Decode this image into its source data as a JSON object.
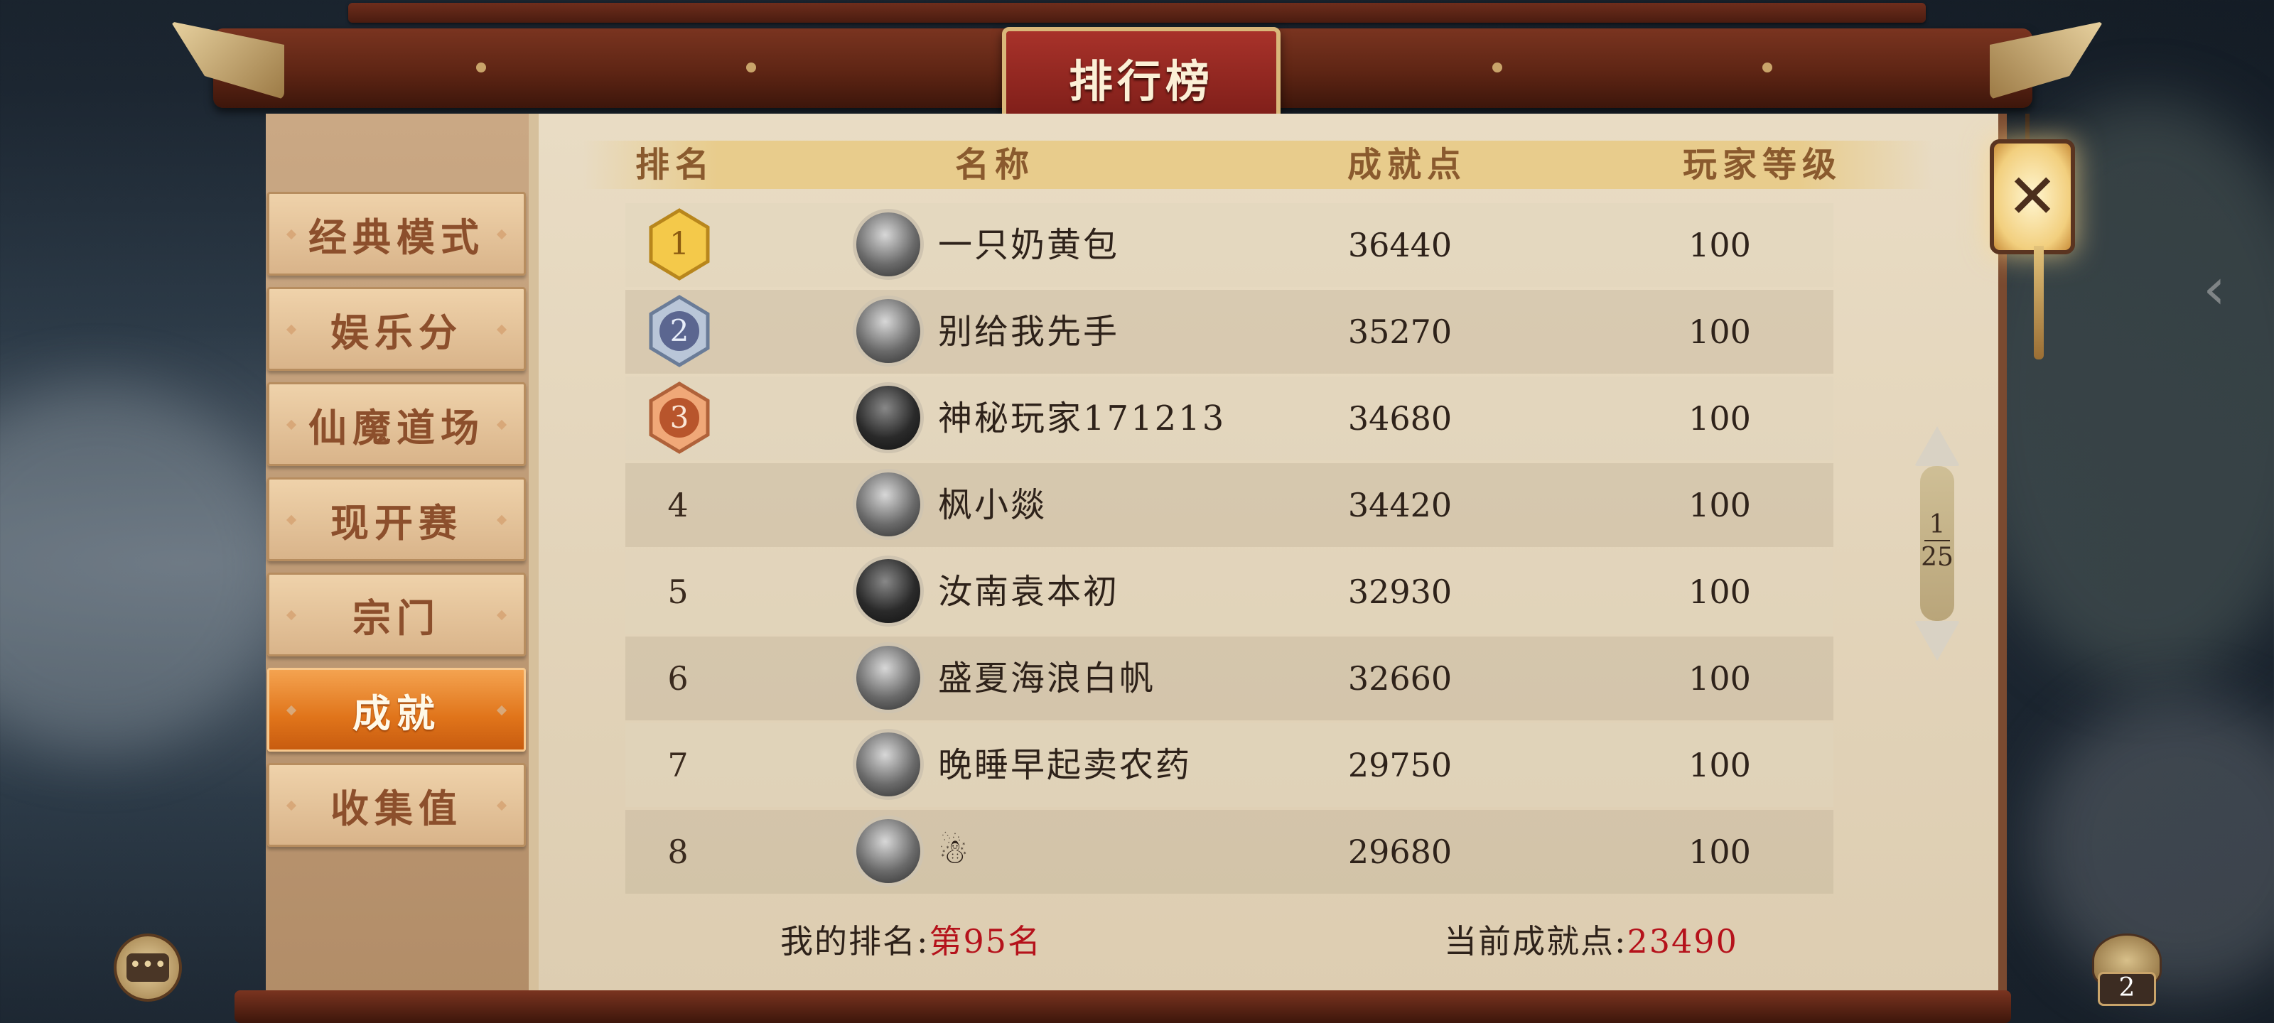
{
  "title": "排行榜",
  "tabs": [
    {
      "label": "经典模式",
      "active": false
    },
    {
      "label": "娱乐分",
      "active": false
    },
    {
      "label": "仙魔道场",
      "active": false
    },
    {
      "label": "现开赛",
      "active": false
    },
    {
      "label": "宗门",
      "active": false
    },
    {
      "label": "成就",
      "active": true
    },
    {
      "label": "收集值",
      "active": false
    }
  ],
  "table": {
    "headers": {
      "rank": "排名",
      "name": "名称",
      "points": "成就点",
      "level": "玩家等级"
    },
    "rows": [
      {
        "rank": "1",
        "name": "一只奶黄包",
        "points": "36440",
        "level": "100",
        "medal": "gold"
      },
      {
        "rank": "2",
        "name": "别给我先手",
        "points": "35270",
        "level": "100",
        "medal": "silver"
      },
      {
        "rank": "3",
        "name": "神秘玩家171213",
        "points": "34680",
        "level": "100",
        "medal": "bronze"
      },
      {
        "rank": "4",
        "name": "枫小燚",
        "points": "34420",
        "level": "100"
      },
      {
        "rank": "5",
        "name": "汝南袁本初",
        "points": "32930",
        "level": "100"
      },
      {
        "rank": "6",
        "name": "盛夏海浪白帆",
        "points": "32660",
        "level": "100"
      },
      {
        "rank": "7",
        "name": "晚睡早起卖农药",
        "points": "29750",
        "level": "100"
      },
      {
        "rank": "8",
        "name": "☃",
        "points": "29680",
        "level": "100"
      }
    ]
  },
  "footer": {
    "my_rank_label": "我的排名:",
    "my_rank_value": "第95名",
    "points_label": "当前成就点:",
    "points_value": "23490"
  },
  "pager": {
    "current": "1",
    "total": "25"
  },
  "close_glyph": "✕",
  "side_arrow": "‹",
  "chat_glyph": "•••",
  "bag_count": "2",
  "colors": {
    "accent_red": "#b5121b",
    "active_tab": "#e0741a",
    "frame_wood": "#5e2514"
  }
}
